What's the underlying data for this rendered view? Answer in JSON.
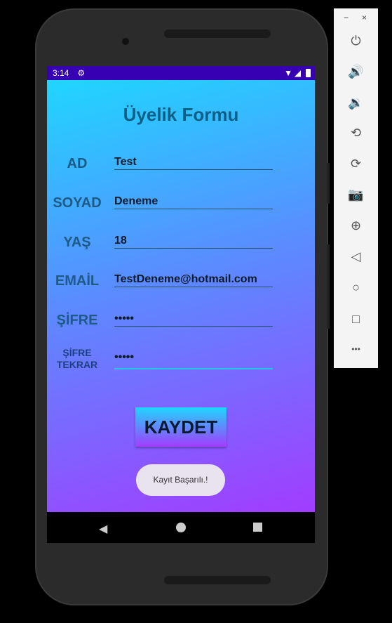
{
  "status": {
    "time": "3:14"
  },
  "form": {
    "title": "Üyelik Formu",
    "fields": [
      {
        "label": "AD",
        "value": "Test"
      },
      {
        "label": "SOYAD",
        "value": "Deneme"
      },
      {
        "label": "YAŞ",
        "value": "18"
      },
      {
        "label": "EMAİL",
        "value": "TestDeneme@hotmail.com"
      },
      {
        "label": "ŞİFRE",
        "value": "•••••"
      },
      {
        "label": "ŞİFRE TEKRAR",
        "value": "•••••"
      }
    ],
    "save_label": "KAYDET",
    "toast": "Kayıt Başarılı.!"
  },
  "toolbar": {
    "minimize": "−",
    "close": "×",
    "more": "•••"
  }
}
